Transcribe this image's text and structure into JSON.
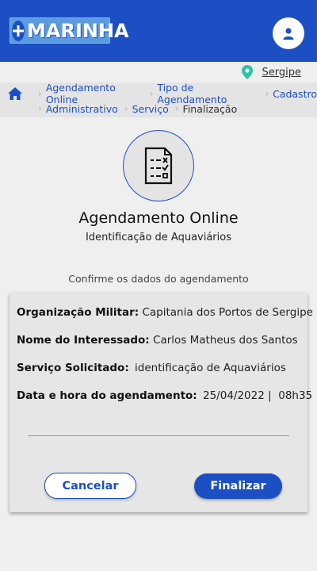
{
  "header": {
    "logo_text": "MARINHA",
    "logo_icon": "plus-icon",
    "avatar_icon": "user-icon",
    "brand_color": "#1d4fc4"
  },
  "location": {
    "icon": "map-pin-icon",
    "label": "Sergipe",
    "pin_color": "#2ec4a0"
  },
  "breadcrumb": {
    "home_icon": "home-icon",
    "items": [
      "Agendamento Online",
      "Tipo de Agendamento",
      "Cadastro",
      "Administrativo",
      "Serviço",
      "Finalização"
    ]
  },
  "page": {
    "icon": "checklist-document-icon",
    "title": "Agendamento Online",
    "subtitle": "Identificação de Aquaviários",
    "confirm_text": "Confirme os dados do agendamento"
  },
  "details": {
    "org_label": "Organização Militar:",
    "org_value": "Capitania dos Portos de Sergipe",
    "name_label": "Nome do Interessado:",
    "name_value": "Carlos Matheus dos Santos",
    "service_label": "Serviço Solicitado:",
    "service_value": "identificação de Aquaviários",
    "date_label": "Data e hora do agendamento:",
    "date_value": "25/04/2022 |  08h35"
  },
  "actions": {
    "cancel_label": "Cancelar",
    "finalize_label": "Finalizar"
  }
}
